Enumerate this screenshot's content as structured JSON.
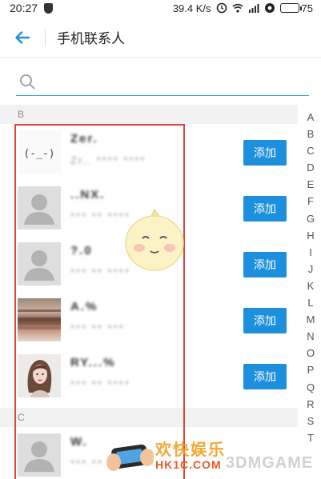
{
  "status_bar": {
    "time": "20:27",
    "network_speed": "39.4 K/s",
    "battery": "75",
    "battery_level": 0.75
  },
  "header": {
    "title": "手机联系人"
  },
  "search": {
    "placeholder": ""
  },
  "sections": [
    {
      "letter": "B",
      "contacts": [
        {
          "name": "Zer.",
          "phone": "Zr.. **** ****",
          "avatar": "emoticon",
          "add_label": "添加"
        },
        {
          "name": "..NX.",
          "phone": "*** ** ****",
          "avatar": "default",
          "add_label": "添加"
        },
        {
          "name": "?.0",
          "phone": "*** ** ****",
          "avatar": "default",
          "add_label": "添加"
        },
        {
          "name": "A.%",
          "phone": "*** ** ***",
          "avatar": "photo-brown",
          "add_label": "添加"
        },
        {
          "name": "RY...%",
          "phone": "*** ** ****",
          "avatar": "photo-girl",
          "add_label": "添加"
        }
      ]
    },
    {
      "letter": "C",
      "contacts": [
        {
          "name": "W.",
          "phone": "*** ** ***",
          "avatar": "default",
          "add_label": ""
        }
      ]
    }
  ],
  "index_letters": [
    "A",
    "B",
    "C",
    "D",
    "E",
    "F",
    "G",
    "H",
    "I",
    "J",
    "K",
    "L",
    "M",
    "N",
    "O",
    "P",
    "Q",
    "R",
    "S",
    "T"
  ],
  "watermark": {
    "text_cn": "欢快娱乐",
    "text_url": "HK1C.COM",
    "text_brand": "3DMGAME"
  },
  "colors": {
    "accent_blue": "#1c8fdd",
    "search_underline": "#38a3d6",
    "highlight_red": "#e0443f"
  }
}
